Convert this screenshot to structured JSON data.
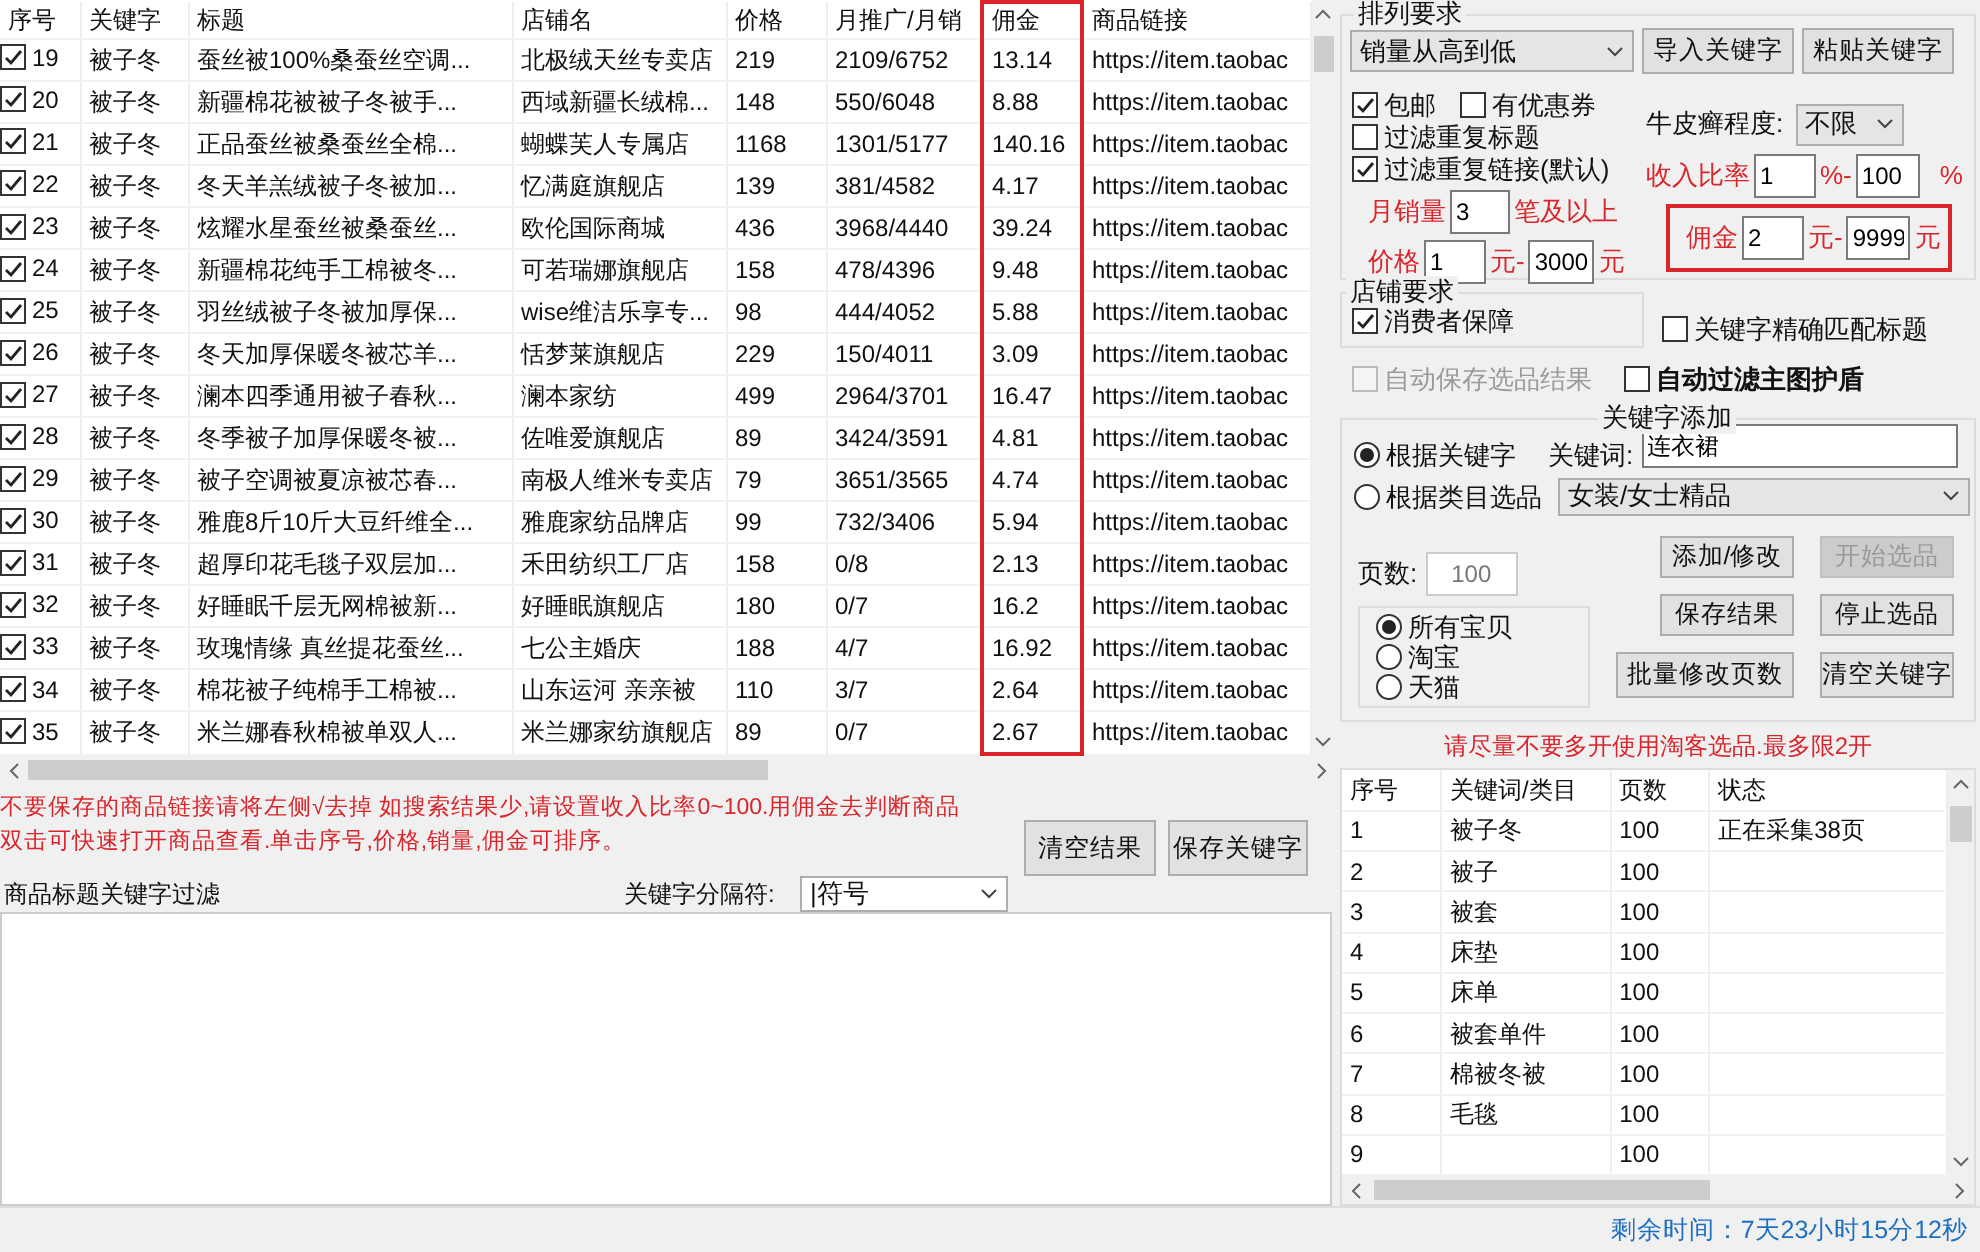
{
  "results_table": {
    "columns": [
      "序号",
      "关键字",
      "标题",
      "店铺名",
      "价格",
      "月推广/月销",
      "佣金",
      "商品链接"
    ],
    "rows": [
      {
        "checked": true,
        "no": "19",
        "keyword": "被子冬",
        "title": "蚕丝被100%桑蚕丝空调...",
        "shop": "北极绒天丝专卖店",
        "price": "219",
        "promo_sales": "2109/6752",
        "commission": "13.14",
        "link": "https://item.taobac"
      },
      {
        "checked": true,
        "no": "20",
        "keyword": "被子冬",
        "title": "新疆棉花被被子冬被手...",
        "shop": "西域新疆长绒棉...",
        "price": "148",
        "promo_sales": "550/6048",
        "commission": "8.88",
        "link": "https://item.taobac"
      },
      {
        "checked": true,
        "no": "21",
        "keyword": "被子冬",
        "title": "正品蚕丝被桑蚕丝全棉...",
        "shop": "蝴蝶芙人专属店",
        "price": "1168",
        "promo_sales": "1301/5177",
        "commission": "140.16",
        "link": "https://item.taobac"
      },
      {
        "checked": true,
        "no": "22",
        "keyword": "被子冬",
        "title": "冬天羊羔绒被子冬被加...",
        "shop": "忆满庭旗舰店",
        "price": "139",
        "promo_sales": "381/4582",
        "commission": "4.17",
        "link": "https://item.taobac"
      },
      {
        "checked": true,
        "no": "23",
        "keyword": "被子冬",
        "title": "炫耀水星蚕丝被桑蚕丝...",
        "shop": "欧伦国际商城",
        "price": "436",
        "promo_sales": "3968/4440",
        "commission": "39.24",
        "link": "https://item.taobac"
      },
      {
        "checked": true,
        "no": "24",
        "keyword": "被子冬",
        "title": "新疆棉花纯手工棉被冬...",
        "shop": "可若瑞娜旗舰店",
        "price": "158",
        "promo_sales": "478/4396",
        "commission": "9.48",
        "link": "https://item.taobac"
      },
      {
        "checked": true,
        "no": "25",
        "keyword": "被子冬",
        "title": "羽丝绒被子冬被加厚保...",
        "shop": "wise维洁乐享专...",
        "price": "98",
        "promo_sales": "444/4052",
        "commission": "5.88",
        "link": "https://item.taobac"
      },
      {
        "checked": true,
        "no": "26",
        "keyword": "被子冬",
        "title": "冬天加厚保暖冬被芯羊...",
        "shop": "恬梦莱旗舰店",
        "price": "229",
        "promo_sales": "150/4011",
        "commission": "3.09",
        "link": "https://item.taobac"
      },
      {
        "checked": true,
        "no": "27",
        "keyword": "被子冬",
        "title": "澜本四季通用被子春秋...",
        "shop": "澜本家纺",
        "price": "499",
        "promo_sales": "2964/3701",
        "commission": "16.47",
        "link": "https://item.taobac"
      },
      {
        "checked": true,
        "no": "28",
        "keyword": "被子冬",
        "title": "冬季被子加厚保暖冬被...",
        "shop": "佐唯爱旗舰店",
        "price": "89",
        "promo_sales": "3424/3591",
        "commission": "4.81",
        "link": "https://item.taobac"
      },
      {
        "checked": true,
        "no": "29",
        "keyword": "被子冬",
        "title": "被子空调被夏凉被芯春...",
        "shop": "南极人维米专卖店",
        "price": "79",
        "promo_sales": "3651/3565",
        "commission": "4.74",
        "link": "https://item.taobac"
      },
      {
        "checked": true,
        "no": "30",
        "keyword": "被子冬",
        "title": "雅鹿8斤10斤大豆纤维全...",
        "shop": "雅鹿家纺品牌店",
        "price": "99",
        "promo_sales": "732/3406",
        "commission": "5.94",
        "link": "https://item.taobac"
      },
      {
        "checked": true,
        "no": "31",
        "keyword": "被子冬",
        "title": "超厚印花毛毯子双层加...",
        "shop": "禾田纺织工厂店",
        "price": "158",
        "promo_sales": "0/8",
        "commission": "2.13",
        "link": "https://item.taobac"
      },
      {
        "checked": true,
        "no": "32",
        "keyword": "被子冬",
        "title": "好睡眠千层无网棉被新...",
        "shop": "好睡眠旗舰店",
        "price": "180",
        "promo_sales": "0/7",
        "commission": "16.2",
        "link": "https://item.taobac"
      },
      {
        "checked": true,
        "no": "33",
        "keyword": "被子冬",
        "title": "玫瑰情缘 真丝提花蚕丝...",
        "shop": "七公主婚庆",
        "price": "188",
        "promo_sales": "4/7",
        "commission": "16.92",
        "link": "https://item.taobac"
      },
      {
        "checked": true,
        "no": "34",
        "keyword": "被子冬",
        "title": "棉花被子纯棉手工棉被...",
        "shop": "山东运河 亲亲被",
        "price": "110",
        "promo_sales": "3/7",
        "commission": "2.64",
        "link": "https://item.taobac"
      },
      {
        "checked": true,
        "no": "35",
        "keyword": "被子冬",
        "title": "米兰娜春秋棉被单双人...",
        "shop": "米兰娜家纺旗舰店",
        "price": "89",
        "promo_sales": "0/7",
        "commission": "2.67",
        "link": "https://item.taobac"
      }
    ]
  },
  "notes": [
    "不要保存的商品链接请将左侧√去掉  如搜索结果少,请设置收入比率0~100.用佣金去判断商品",
    "双击可快速打开商品查看.单击序号,价格,销量,佣金可排序。"
  ],
  "left_buttons": [
    "清空结果",
    "保存关键字"
  ],
  "separator": {
    "label": "关键字分隔符:",
    "value": "|符号"
  },
  "filter": {
    "label": "商品标题关键字过滤"
  },
  "sort": {
    "title": "排列要求",
    "value": "销量从高到低"
  },
  "sort_buttons": [
    "导入关键字",
    "粘贴关键字"
  ],
  "options": [
    {
      "label": "包邮",
      "checked": true
    },
    {
      "label": "有优惠券",
      "checked": false
    },
    {
      "label": "过滤重复标题",
      "checked": false
    },
    {
      "label": "过滤重复链接(默认)",
      "checked": true
    }
  ],
  "psoriasis": {
    "label": "牛皮癣程度:",
    "value": "不限"
  },
  "income_ratio": {
    "label": "收入比率",
    "min": "1",
    "separator": "%-",
    "max": "100",
    "unit": "%"
  },
  "monthly_sales": {
    "label": "月销量",
    "value": "3",
    "unit": "笔及以上"
  },
  "price": {
    "label": "价格",
    "min": "1",
    "separator": "元-",
    "max": "3000",
    "unit": "元"
  },
  "commission": {
    "label": "佣金",
    "min": "2",
    "separator": "元-",
    "max": "9999",
    "unit": "元"
  },
  "shop_requirements": {
    "title": "店铺要求",
    "items": [
      {
        "label": "消费者保障",
        "checked": true
      }
    ]
  },
  "exact_match": {
    "label": "关键字精确匹配标题",
    "checked": false
  },
  "auto_save": {
    "label": "自动保存选品结果",
    "checked": false,
    "disabled": true
  },
  "auto_filter": {
    "label": "自动过滤主图护盾",
    "checked": false
  },
  "keyword_add": {
    "title": "关键字添加",
    "modes": [
      {
        "label": "根据关键字",
        "selected": true
      },
      {
        "label": "根据类目选品",
        "selected": false
      }
    ],
    "keyword_label": "关键词:",
    "keyword_value": "连衣裙",
    "category": "女装/女士精品",
    "pages_label": "页数:",
    "pages_value": "100",
    "platforms": [
      {
        "label": "所有宝贝",
        "selected": true
      },
      {
        "label": "淘宝",
        "selected": false
      },
      {
        "label": "天猫",
        "selected": false
      }
    ],
    "buttons": [
      {
        "label": "添加/修改",
        "disabled": false
      },
      {
        "label": "开始选品",
        "disabled": true
      },
      {
        "label": "保存结果",
        "disabled": false
      },
      {
        "label": "停止选品",
        "disabled": false
      },
      {
        "label": "批量修改页数",
        "disabled": false
      },
      {
        "label": "清空关键字",
        "disabled": false
      }
    ],
    "warning": "请尽量不要多开使用淘客选品.最多限2开"
  },
  "keyword_table": {
    "columns": [
      "序号",
      "关键词/类目",
      "页数",
      "状态"
    ],
    "rows": [
      {
        "no": "1",
        "keyword": "被子冬",
        "pages": "100",
        "status": "正在采集38页"
      },
      {
        "no": "2",
        "keyword": "被子",
        "pages": "100"
      },
      {
        "no": "3",
        "keyword": "被套",
        "pages": "100"
      },
      {
        "no": "4",
        "keyword": "床垫",
        "pages": "100"
      },
      {
        "no": "5",
        "keyword": "床单",
        "pages": "100"
      },
      {
        "no": "6",
        "keyword": "被套单件",
        "pages": "100"
      },
      {
        "no": "7",
        "keyword": "棉被冬被",
        "pages": "100"
      },
      {
        "no": "8",
        "keyword": "毛毯",
        "pages": "100"
      },
      {
        "no": "9",
        "pages": "100"
      }
    ]
  },
  "status_bar": {
    "remaining": "剩余时间：7天23小时15分12秒"
  }
}
